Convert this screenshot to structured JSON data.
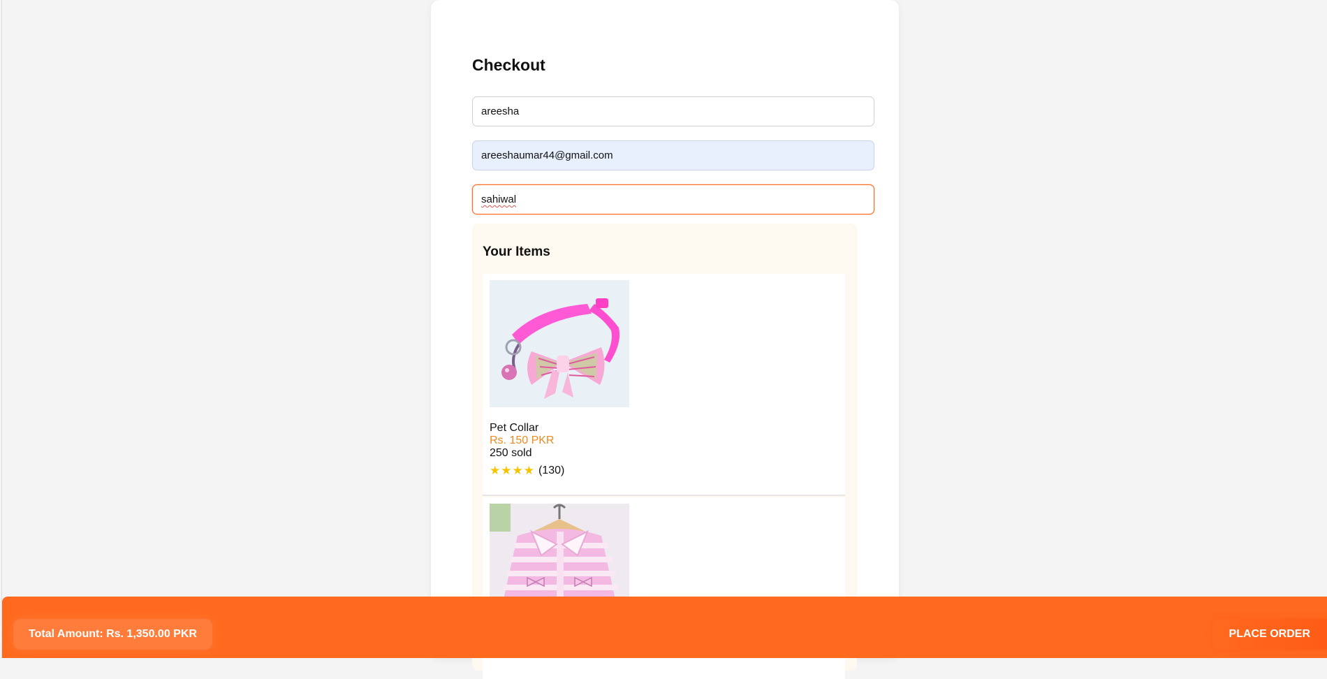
{
  "checkout": {
    "title": "Checkout",
    "name_value": "areesha",
    "email_value": "areeshaumar44@gmail.com",
    "city_value": "sahiwal"
  },
  "items_section": {
    "title": "Your Items",
    "items": [
      {
        "name": "Pet Collar",
        "price": "Rs. 150 PKR",
        "sold": "250 sold",
        "stars": "★★★★",
        "reviews": "(130)",
        "image": "pink-pet-collar-with-bow-image"
      },
      {
        "image": "pink-striped-pet-sweater-image"
      }
    ]
  },
  "footer": {
    "total_label": "Total Amount: Rs. 1,350.00 PKR",
    "place_order_label": "PLACE ORDER"
  },
  "colors": {
    "accent": "#ff6a1f",
    "price": "#f08a1c",
    "star": "#f5c400",
    "panel": "#fdf9f0",
    "autofill": "#e8f0fd"
  }
}
